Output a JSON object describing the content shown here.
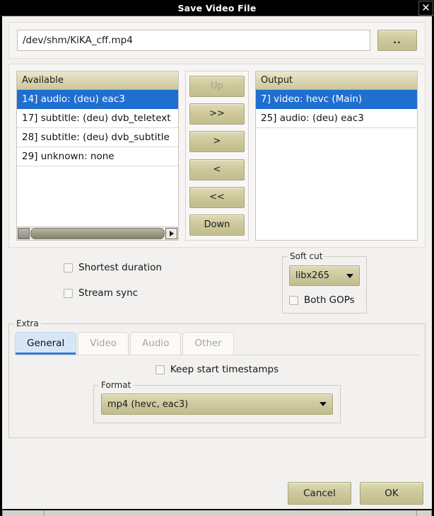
{
  "window": {
    "title": "Save Video File",
    "close_label": "✕"
  },
  "file": {
    "path": "/dev/shm/KiKA_cff.mp4",
    "placeholder": "",
    "browse_label": ".."
  },
  "available_list": {
    "header": "Available",
    "items": [
      {
        "label": "14] audio: (deu) eac3",
        "selected": true
      },
      {
        "label": "17] subtitle: (deu) dvb_teletext",
        "selected": false
      },
      {
        "label": "28] subtitle: (deu) dvb_subtitle",
        "selected": false
      },
      {
        "label": "29] unknown: none",
        "selected": false
      }
    ]
  },
  "output_list": {
    "header": "Output",
    "items": [
      {
        "label": "7] video: hevc (Main)",
        "selected": true
      },
      {
        "label": "25] audio: (deu) eac3",
        "selected": false
      }
    ]
  },
  "transfer_buttons": [
    {
      "label": "Up",
      "disabled": true
    },
    {
      "label": ">>",
      "disabled": false
    },
    {
      "label": ">",
      "disabled": false
    },
    {
      "label": "<",
      "disabled": false
    },
    {
      "label": "<<",
      "disabled": false
    },
    {
      "label": "Down",
      "disabled": false
    }
  ],
  "options": {
    "shortest_duration": {
      "label": "Shortest duration",
      "checked": false
    },
    "stream_sync": {
      "label": "Stream sync",
      "checked": false
    }
  },
  "soft_cut": {
    "title": "Soft cut",
    "encoder": "libx265",
    "both_gops": {
      "label": "Both GOPs",
      "checked": false
    }
  },
  "extra": {
    "title": "Extra",
    "tabs": [
      {
        "label": "General",
        "active": true
      },
      {
        "label": "Video",
        "active": false
      },
      {
        "label": "Audio",
        "active": false
      },
      {
        "label": "Other",
        "active": false
      }
    ],
    "keep_start_timestamps": {
      "label": "Keep start timestamps",
      "checked": false
    },
    "format": {
      "title": "Format",
      "value": "mp4 (hevc, eac3)"
    }
  },
  "footer": {
    "cancel_label": "Cancel",
    "ok_label": "OK"
  },
  "colors": {
    "selection_blue": "#1f6fd0",
    "button_khaki": "#cdc99c",
    "active_tab_blue": "#2f7fd4",
    "titlebar_black": "#000000"
  }
}
